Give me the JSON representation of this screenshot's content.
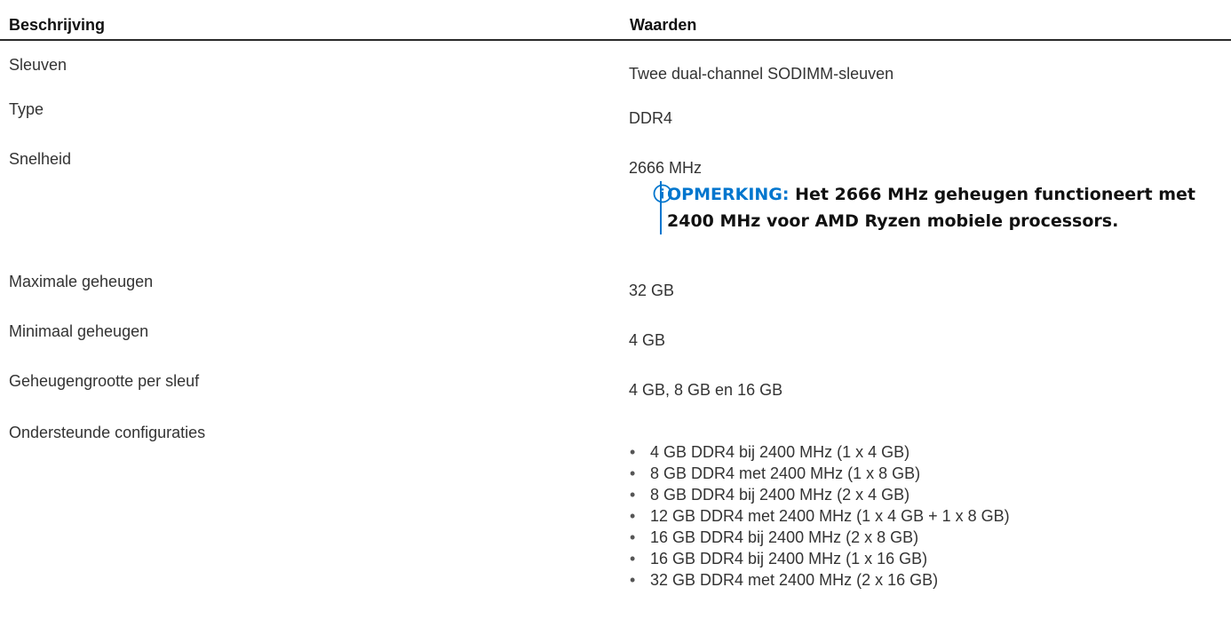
{
  "header": {
    "description": "Beschrijving",
    "values": "Waarden"
  },
  "rows": [
    {
      "label": "Sleuven",
      "value": "Twee dual-channel SODIMM-sleuven"
    },
    {
      "label": "Type",
      "value": "DDR4"
    },
    {
      "label": "Snelheid",
      "value": "2666 MHz",
      "note": {
        "label": "OPMERKING:",
        "text": "Het 2666 MHz geheugen functioneert met 2400 MHz voor AMD Ryzen mobiele processors.",
        "icon": "info-icon",
        "accent_color": "#0076ce"
      }
    },
    {
      "label": "Maximale geheugen",
      "value": "32 GB"
    },
    {
      "label": "Minimaal geheugen",
      "value": "4 GB"
    },
    {
      "label": "Geheugengrootte per sleuf",
      "value": "4 GB, 8 GB en 16 GB"
    },
    {
      "label": "Ondersteunde configuraties",
      "bullet": "•",
      "items": [
        "4 GB DDR4 bij 2400 MHz (1 x 4 GB)",
        "8 GB DDR4 met 2400 MHz (1 x 8 GB)",
        "8 GB DDR4 bij 2400 MHz (2 x 4 GB)",
        "12 GB DDR4 met 2400 MHz (1 x 4 GB + 1 x 8 GB)",
        "16 GB DDR4 bij 2400 MHz (2 x 8 GB)",
        "16 GB DDR4 bij 2400 MHz (1 x 16 GB)",
        "32 GB DDR4 met 2400 MHz (2 x 16 GB)"
      ]
    }
  ]
}
